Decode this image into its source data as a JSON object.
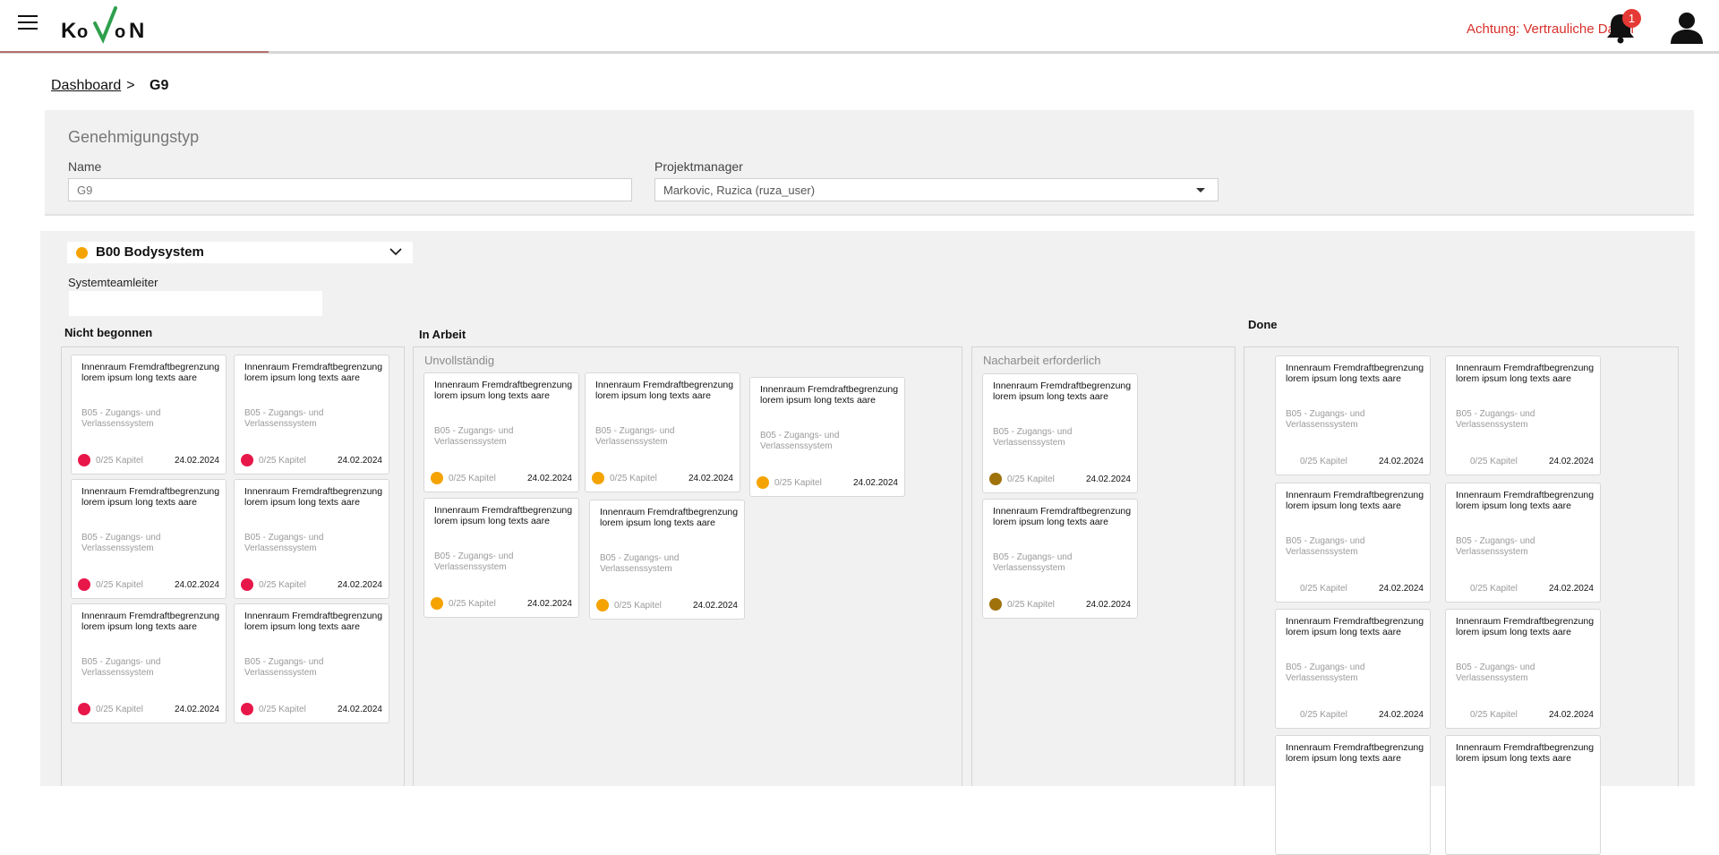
{
  "header": {
    "logo_text": "KoVoN",
    "warning": "Achtung: Vertrauliche Daten",
    "notification_count": "1",
    "icons": {
      "menu": "hamburger-menu-icon",
      "bell": "bell-icon",
      "user": "user-icon"
    },
    "colors": {
      "warning": "#d9302b",
      "badge": "#e53935"
    }
  },
  "breadcrumb": {
    "parent": "Dashboard",
    "separator": ">",
    "current": "G9"
  },
  "genehmigung": {
    "title": "Genehmigungstyp",
    "name_label": "Name",
    "name_value": "G9",
    "pm_label": "Projektmanager",
    "pm_value": "Markovic, Ruzica (ruza_user)"
  },
  "system": {
    "label": "B00 Bodysystem",
    "status_color": "#f5a300",
    "teamleiter_label": "Systemteamleiter",
    "teamleiter_value": ""
  },
  "columns": {
    "nicht_begonnen": {
      "title": "Nicht begonnen"
    },
    "in_arbeit": {
      "title": "In Arbeit",
      "unvollstaendig": "Unvollständig",
      "nacharbeit": "Nacharbeit erforderlich"
    },
    "done": {
      "title": "Done"
    }
  },
  "status_colors": {
    "red": "#e8174a",
    "orange": "#f5a300",
    "brown": "#a0720c"
  },
  "cards": {
    "nb": [
      {
        "title": "Innenraum Fremdraftbegrenzung lorem ipsum long texts aare",
        "sub": "B05 - Zugangs- und Verlassenssystem",
        "kapitel": "0/25 Kapitel",
        "date": "24.02.2024"
      },
      {
        "title": "Innenraum Fremdraftbegrenzung lorem ipsum long texts aare",
        "sub": "B05 - Zugangs- und Verlassenssystem",
        "kapitel": "0/25 Kapitel",
        "date": "24.02.2024"
      },
      {
        "title": "Innenraum Fremdraftbegrenzung lorem ipsum long texts aare",
        "sub": "B05 - Zugangs- und Verlassenssystem",
        "kapitel": "0/25 Kapitel",
        "date": "24.02.2024"
      },
      {
        "title": "Innenraum Fremdraftbegrenzung lorem ipsum long texts aare",
        "sub": "B05 - Zugangs- und Verlassenssystem",
        "kapitel": "0/25 Kapitel",
        "date": "24.02.2024"
      },
      {
        "title": "Innenraum Fremdraftbegrenzung lorem ipsum long texts aare",
        "sub": "B05 - Zugangs- und Verlassenssystem",
        "kapitel": "0/25 Kapitel",
        "date": "24.02.2024"
      },
      {
        "title": "Innenraum Fremdraftbegrenzung lorem ipsum long texts aare",
        "sub": "B05 - Zugangs- und Verlassenssystem",
        "kapitel": "0/25 Kapitel",
        "date": "24.02.2024"
      }
    ],
    "unv": [
      {
        "title": "Innenraum Fremdraftbegrenzung lorem ipsum long texts aare",
        "sub": "B05 - Zugangs- und Verlassenssystem",
        "kapitel": "0/25 Kapitel",
        "date": "24.02.2024"
      },
      {
        "title": "Innenraum Fremdraftbegrenzung lorem ipsum long texts aare",
        "sub": "B05 - Zugangs- und Verlassenssystem",
        "kapitel": "0/25 Kapitel",
        "date": "24.02.2024"
      },
      {
        "title": "Innenraum Fremdraftbegrenzung lorem ipsum long texts aare",
        "sub": "B05 - Zugangs- und Verlassenssystem",
        "kapitel": "0/25 Kapitel",
        "date": "24.02.2024"
      },
      {
        "title": "Innenraum Fremdraftbegrenzung lorem ipsum long texts aare",
        "sub": "B05 - Zugangs- und Verlassenssystem",
        "kapitel": "0/25 Kapitel",
        "date": "24.02.2024"
      },
      {
        "title": "Innenraum Fremdraftbegrenzung lorem ipsum long texts aare",
        "sub": "B05 - Zugangs- und Verlassenssystem",
        "kapitel": "0/25 Kapitel",
        "date": "24.02.2024"
      }
    ],
    "nach": [
      {
        "title": "Innenraum Fremdraftbegrenzung lorem ipsum long texts aare",
        "sub": "B05 - Zugangs- und Verlassenssystem",
        "kapitel": "0/25 Kapitel",
        "date": "24.02.2024"
      },
      {
        "title": "Innenraum Fremdraftbegrenzung lorem ipsum long texts aare",
        "sub": "B05 - Zugangs- und Verlassenssystem",
        "kapitel": "0/25 Kapitel",
        "date": "24.02.2024"
      }
    ],
    "done": [
      {
        "title": "Innenraum Fremdraftbegrenzung lorem ipsum long texts aare",
        "sub": "B05 - Zugangs- und Verlassenssystem",
        "kapitel": "0/25 Kapitel",
        "date": "24.02.2024"
      },
      {
        "title": "Innenraum Fremdraftbegrenzung lorem ipsum long texts aare",
        "sub": "B05 - Zugangs- und Verlassenssystem",
        "kapitel": "0/25 Kapitel",
        "date": "24.02.2024"
      },
      {
        "title": "Innenraum Fremdraftbegrenzung lorem ipsum long texts aare",
        "sub": "B05 - Zugangs- und Verlassenssystem",
        "kapitel": "0/25 Kapitel",
        "date": "24.02.2024"
      },
      {
        "title": "Innenraum Fremdraftbegrenzung lorem ipsum long texts aare",
        "sub": "B05 - Zugangs- und Verlassenssystem",
        "kapitel": "0/25 Kapitel",
        "date": "24.02.2024"
      },
      {
        "title": "Innenraum Fremdraftbegrenzung lorem ipsum long texts aare",
        "sub": "B05 - Zugangs- und Verlassenssystem",
        "kapitel": "0/25 Kapitel",
        "date": "24.02.2024"
      },
      {
        "title": "Innenraum Fremdraftbegrenzung lorem ipsum long texts aare",
        "sub": "B05 - Zugangs- und Verlassenssystem",
        "kapitel": "0/25 Kapitel",
        "date": "24.02.2024"
      },
      {
        "title": "Innenraum Fremdraftbegrenzung lorem ipsum long texts aare",
        "sub": "",
        "kapitel": "",
        "date": ""
      },
      {
        "title": "Innenraum Fremdraftbegrenzung lorem ipsum long texts aare",
        "sub": "",
        "kapitel": "",
        "date": ""
      }
    ]
  }
}
